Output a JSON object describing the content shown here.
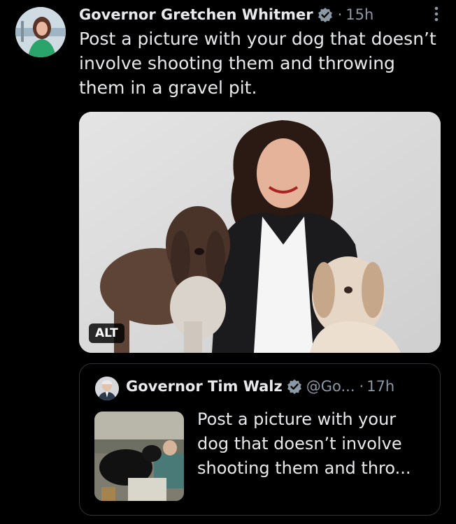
{
  "tweet": {
    "author_name": "Governor Gretchen Whitmer",
    "separator": "·",
    "time": "15h",
    "text": "Post a picture with your dog that doesn’t involve shooting them and throwing them in a gravel pit.",
    "media": {
      "alt_badge": "ALT"
    }
  },
  "quoted_tweet": {
    "author_name": "Governor Tim Walz",
    "handle": "@Go...",
    "separator": "·",
    "time": "17h",
    "text": "Post a picture with your dog that doesn’t involve shooting them and thro..."
  },
  "colors": {
    "background": "#000000",
    "text": "#e7e9ea",
    "muted": "#8b98a5",
    "verified_badge": "#8b98a5",
    "border": "#2f3336"
  },
  "icons": {
    "verified": "verified-badge-icon",
    "more": "more-options-icon"
  }
}
